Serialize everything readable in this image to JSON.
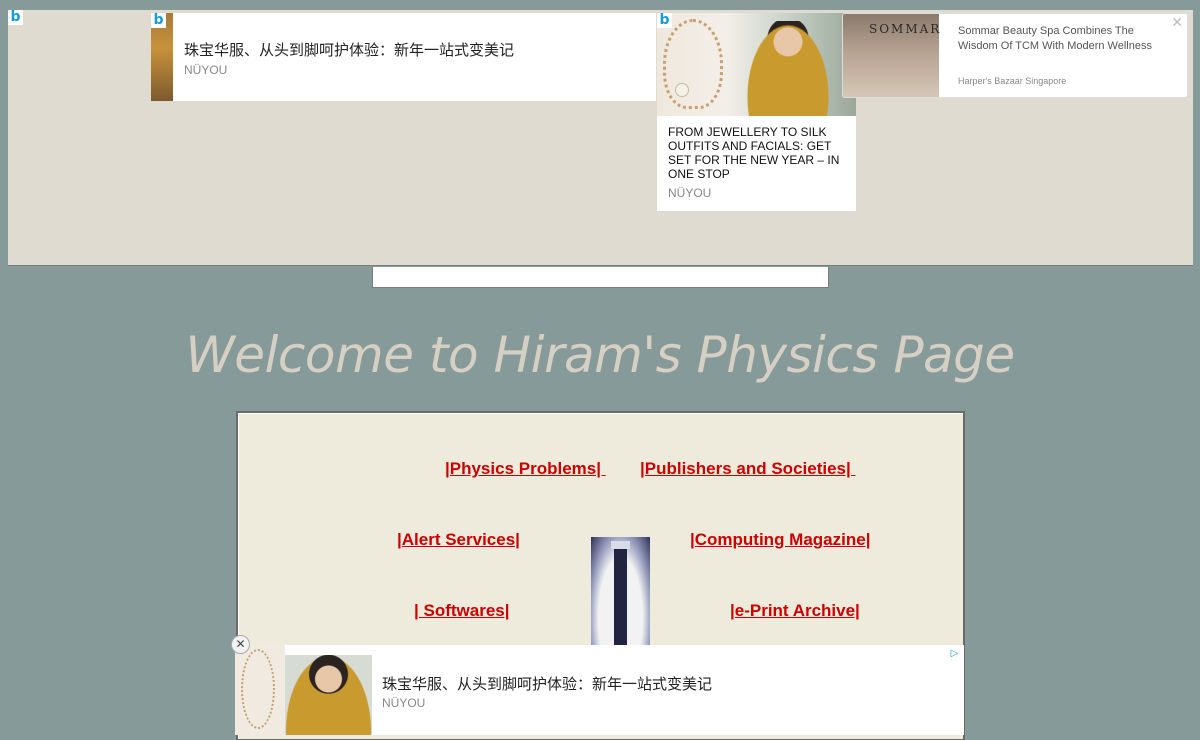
{
  "top_ads": {
    "logo_glyph": "b",
    "banner": {
      "title": "珠宝华服、从头到脚呵护体验：新年一站式变美记",
      "source": "NÜYOU"
    },
    "card": {
      "title": "FROM JEWELLERY TO SILK OUTFITS AND FACIALS: GET SET FOR THE NEW YEAR – IN ONE STOP",
      "source": "NÜYOU"
    },
    "side": {
      "brand": "SOMMAR",
      "title": "Sommar Beauty Spa Combines The Wisdom Of TCM With Modern Wellness",
      "source": "Harper's Bazaar Singapore",
      "close_glyph": "✕"
    },
    "adchoice_glyph": "▷"
  },
  "page": {
    "title": "Welcome to Hiram's Physics Page"
  },
  "nav": {
    "links": [
      {
        "label": "|Physics Problems| "
      },
      {
        "label": "|Publishers and Societies| "
      },
      {
        "label": "|Alert Services|"
      },
      {
        "label": "|Computing Magazine|"
      },
      {
        "label": "| Softwares|"
      },
      {
        "label": "|e-Print Archive|"
      }
    ],
    "link_color": "#cc0000"
  },
  "bottom_ad": {
    "title": "珠宝华服、从头到脚呵护体验：新年一站式变美记",
    "source": "NÜYOU",
    "close_glyph": "✕"
  },
  "colors": {
    "background": "#869a9a",
    "ad_area": "#e0dbd0",
    "nav_box": "#eeeadc",
    "title": "#d5d0c3"
  }
}
